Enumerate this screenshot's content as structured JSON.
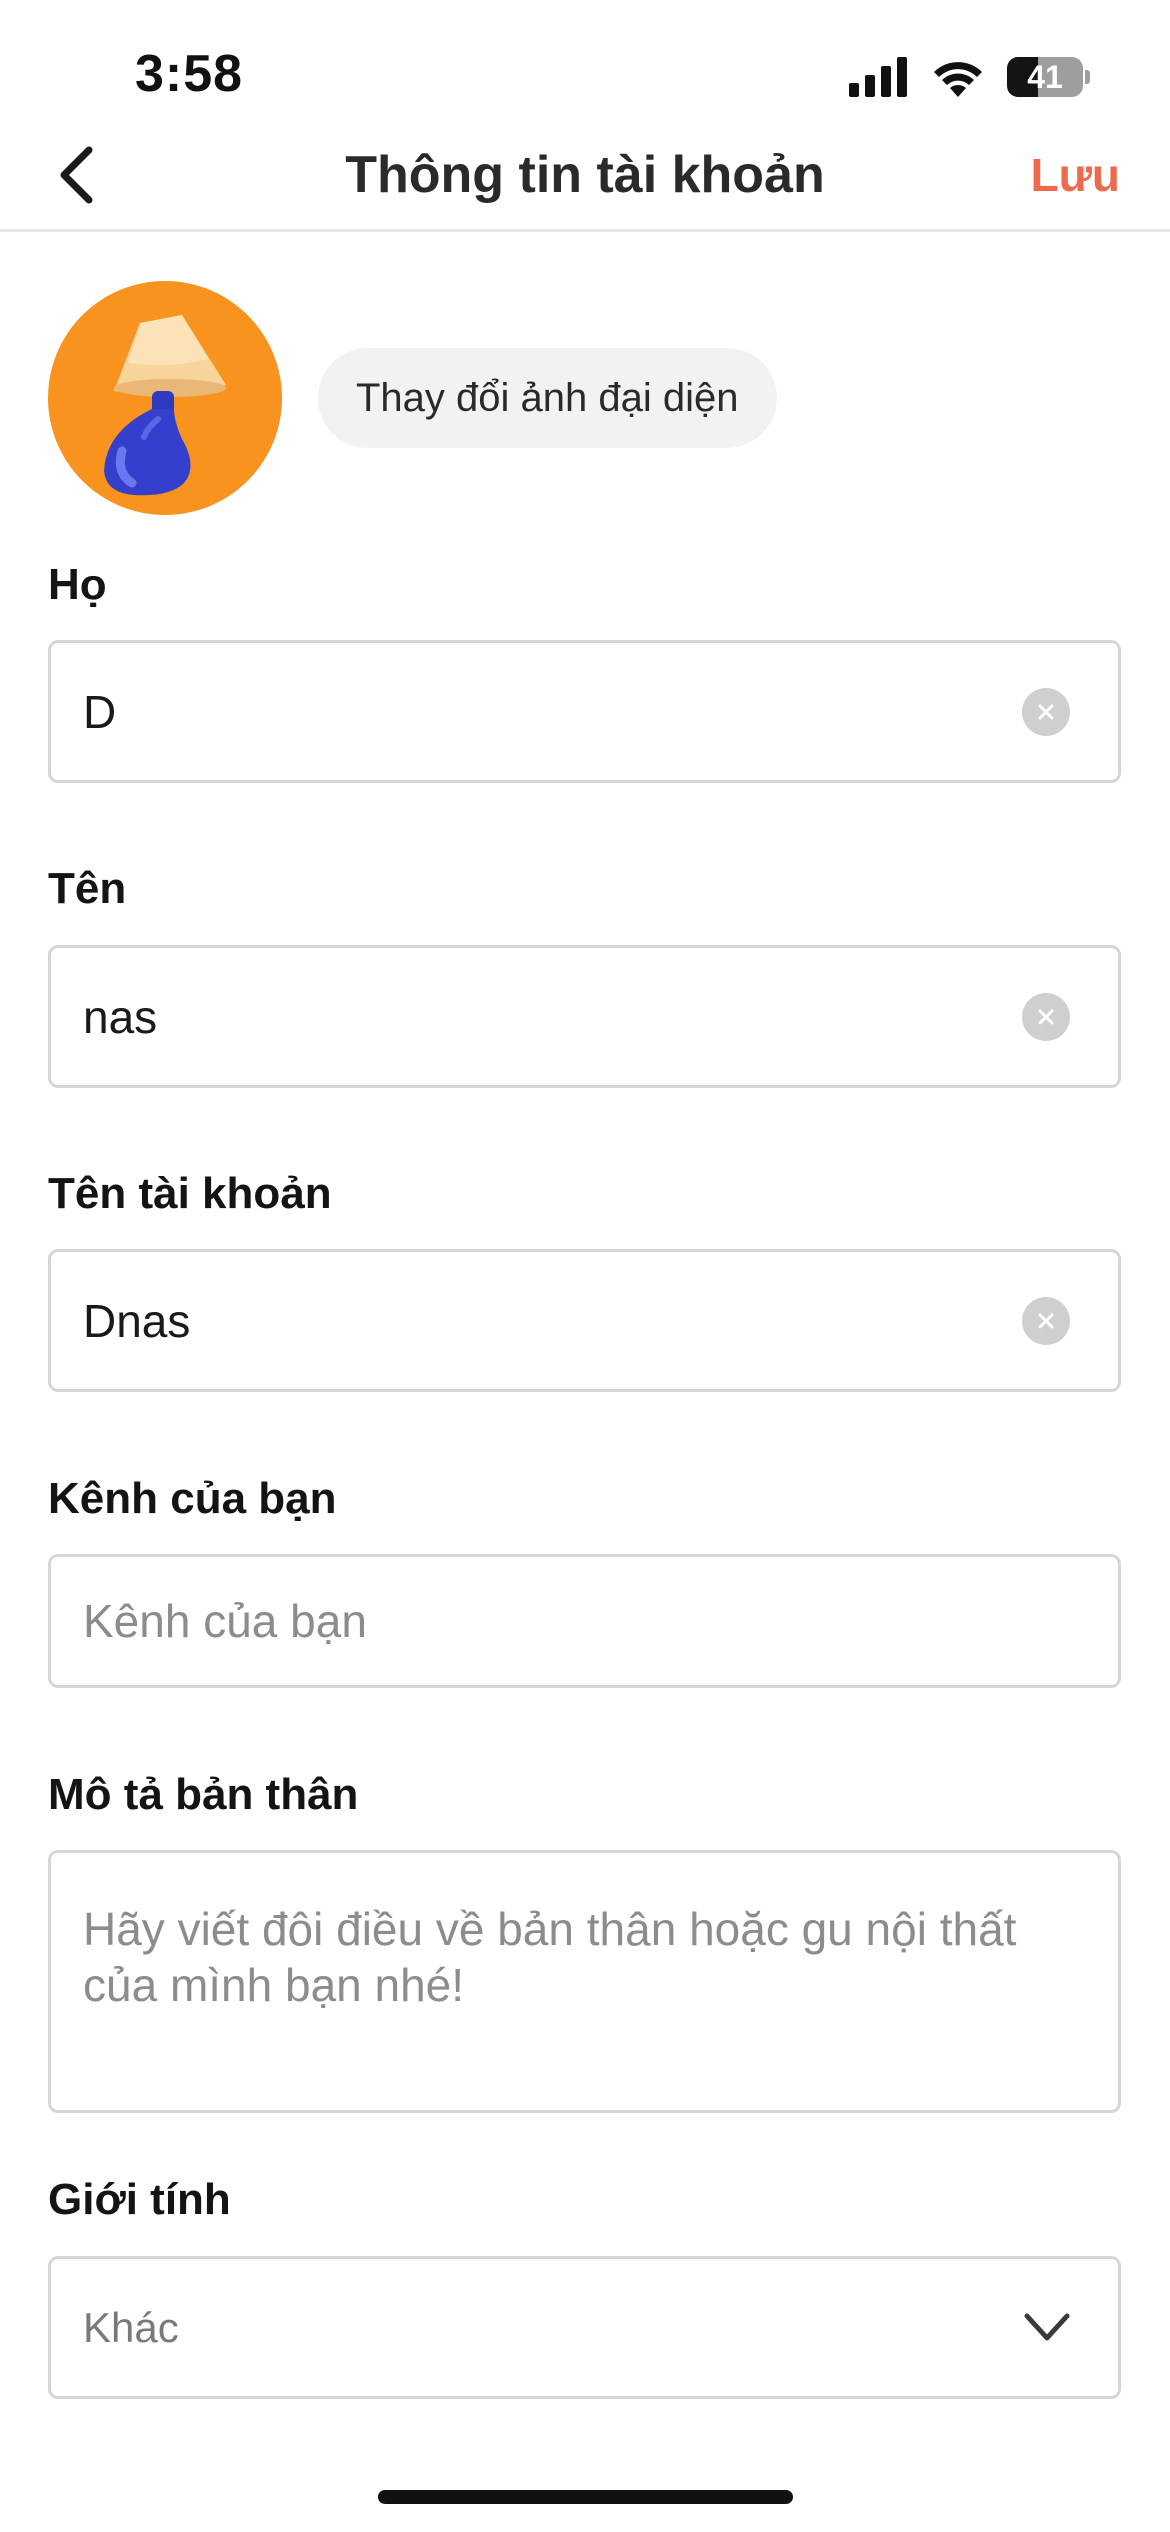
{
  "status_bar": {
    "time": "3:58",
    "battery_level": "41",
    "battery_fraction": 0.41,
    "icons": [
      "signal-icon",
      "wifi-icon",
      "battery-icon"
    ]
  },
  "nav": {
    "title": "Thông tin tài khoản",
    "save_label": "Lưu",
    "back_icon": "chevron-left-icon",
    "accent_color": "#ee6a4e"
  },
  "avatar": {
    "change_label": "Thay đổi ảnh đại diện",
    "background_color": "#f7931e",
    "image": "lamp-illustration"
  },
  "form": {
    "last_name": {
      "label": "Họ",
      "value": "D"
    },
    "first_name": {
      "label": "Tên",
      "value": "nas"
    },
    "username": {
      "label": "Tên tài khoản",
      "value": "Dnas"
    },
    "channel": {
      "label": "Kênh của bạn",
      "placeholder": "Kênh của bạn"
    },
    "bio": {
      "label": "Mô tả bản thân",
      "placeholder": "Hãy viết đôi điều về bản thân hoặc gu nội thất của mình bạn nhé!"
    },
    "gender": {
      "label": "Giới tính",
      "value": "Khác"
    }
  }
}
